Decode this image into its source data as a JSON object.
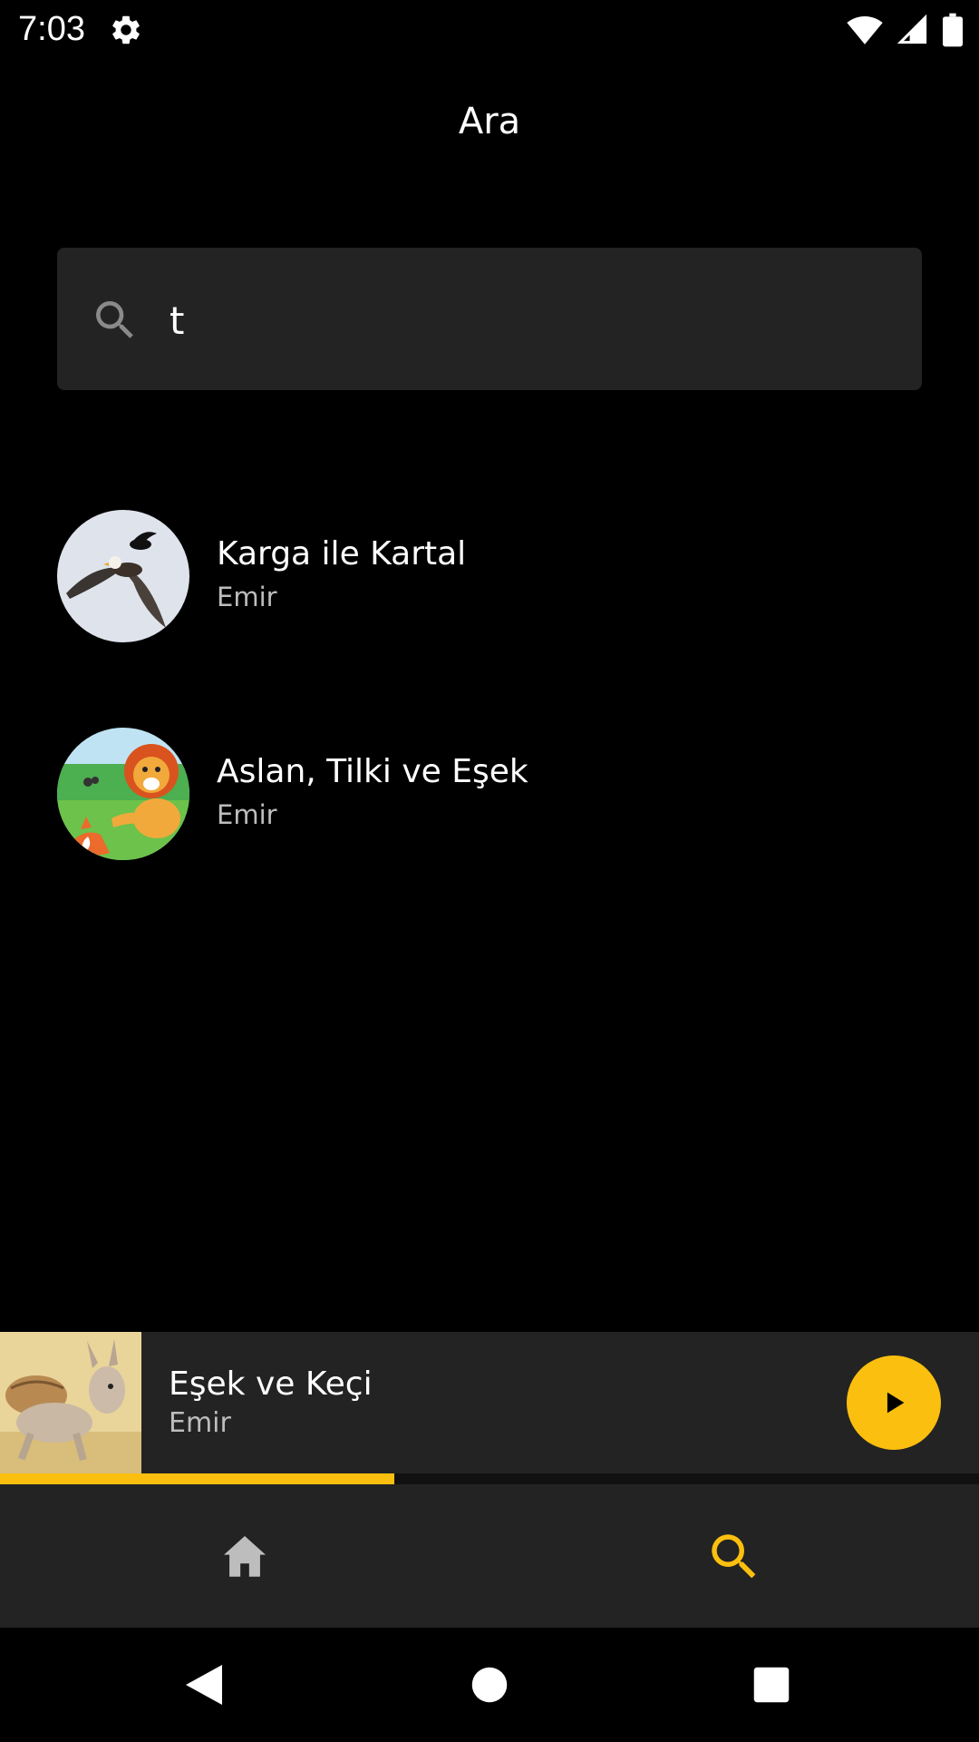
{
  "status_bar": {
    "time": "7:03",
    "icons": [
      "settings-icon",
      "wifi-icon",
      "signal-icon",
      "battery-icon"
    ]
  },
  "page": {
    "title": "Ara"
  },
  "search": {
    "value": "t",
    "placeholder": ""
  },
  "results": [
    {
      "title": "Karga ile Kartal",
      "author": "Emir",
      "image": "crow-eagle-illustration"
    },
    {
      "title": "Aslan, Tilki ve Eşek",
      "author": "Emir",
      "image": "lion-fox-illustration"
    }
  ],
  "player": {
    "title": "Eşek ve Keçi",
    "author": "Emir",
    "image": "donkey-illustration",
    "progress": 0.403,
    "icon": "play-icon"
  },
  "bottom_nav": {
    "items": [
      {
        "name": "home",
        "icon": "home-icon",
        "active": false
      },
      {
        "name": "search",
        "icon": "search-icon",
        "active": true
      }
    ]
  },
  "system_nav": {
    "icons": [
      "back-icon",
      "home-circle-icon",
      "recents-icon"
    ]
  },
  "colors": {
    "accent": "#fbbf0f",
    "surface": "#232323",
    "background": "#000000",
    "subtext": "#bdbdbd"
  }
}
